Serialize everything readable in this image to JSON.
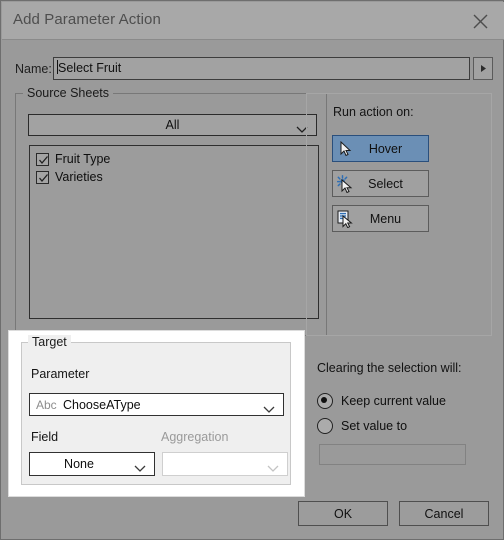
{
  "window": {
    "title": "Add Parameter Action",
    "close_icon": "close-icon"
  },
  "name_row": {
    "label": "Name:",
    "value": "Select Fruit",
    "more_icon": "triangle-right-icon"
  },
  "source_sheets": {
    "legend": "Source Sheets",
    "sheet_filter": {
      "value": "All",
      "chevron_icon": "chevron-down-icon"
    },
    "items": [
      {
        "label": "Fruit Type",
        "checked": true,
        "check_icon": "checkmark-icon"
      },
      {
        "label": "Varieties",
        "checked": true,
        "check_icon": "checkmark-icon"
      }
    ]
  },
  "run_action": {
    "label": "Run action on:",
    "buttons": [
      {
        "label": "Hover",
        "icon": "mouse-pointer-icon",
        "selected": true
      },
      {
        "label": "Select",
        "icon": "mouse-pointer-click-icon",
        "selected": false
      },
      {
        "label": "Menu",
        "icon": "mouse-pointer-menu-icon",
        "selected": false
      }
    ]
  },
  "target": {
    "legend": "Target",
    "parameter_label": "Parameter",
    "parameter_value": "ChooseAType",
    "parameter_type_badge": "Abc",
    "parameter_chevron_icon": "chevron-down-icon",
    "field_label": "Field",
    "field_value": "None",
    "field_chevron_icon": "chevron-down-icon",
    "aggregation_label": "Aggregation",
    "aggregation_value": "",
    "aggregation_chevron_icon": "chevron-down-icon"
  },
  "clearing": {
    "label": "Clearing the selection will:",
    "options": [
      {
        "label": "Keep current value",
        "selected": true
      },
      {
        "label": "Set value to",
        "selected": false
      }
    ],
    "set_value_input": ""
  },
  "footer": {
    "ok_label": "OK",
    "cancel_label": "Cancel"
  },
  "colors": {
    "dialog_background": "#9a9a9a",
    "titlebar": "#a8a8a8",
    "selected_button": "#6b8fb5",
    "selected_button_border": "#2a4f7c",
    "spotlight_background": "#ffffff",
    "target_panel": "#efefef"
  }
}
